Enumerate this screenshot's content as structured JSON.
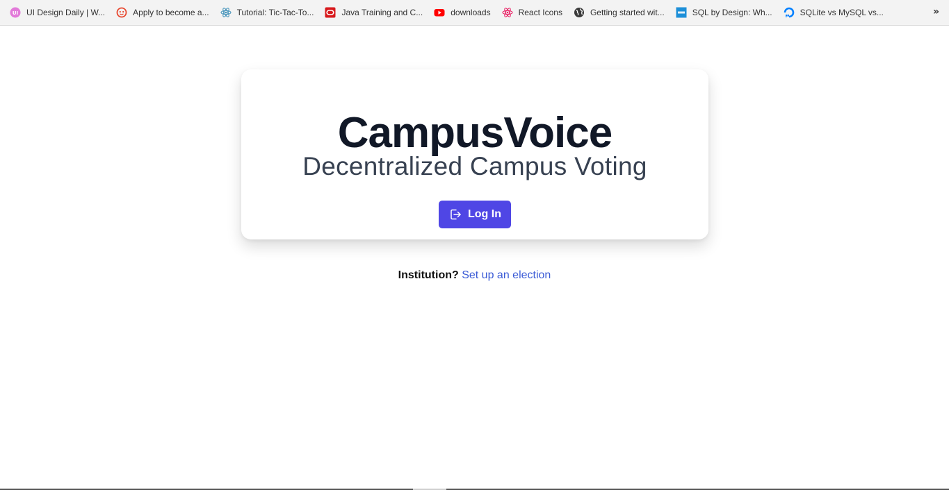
{
  "bookmarks": [
    {
      "label": "UI Design Daily | W...",
      "icon": "ui-design-daily-icon"
    },
    {
      "label": "Apply to become a...",
      "icon": "smiley-face-icon"
    },
    {
      "label": "Tutorial: Tic-Tac-To...",
      "icon": "react-atom-icon"
    },
    {
      "label": "Java Training and C...",
      "icon": "oracle-icon"
    },
    {
      "label": "downloads",
      "icon": "youtube-icon"
    },
    {
      "label": "React Icons",
      "icon": "react-icons-icon"
    },
    {
      "label": "Getting started wit...",
      "icon": "globe-icon"
    },
    {
      "label": "SQL by Design: Wh...",
      "icon": "itpro-icon"
    },
    {
      "label": "SQLite vs MySQL vs...",
      "icon": "digitalocean-icon"
    }
  ],
  "overflow_icon": "chevron-double-right-icon",
  "overflow_glyph": "»",
  "card": {
    "title": "CampusVoice",
    "subtitle": "Decentralized Campus Voting",
    "login_label": "Log In",
    "login_icon": "sign-in-icon"
  },
  "footer": {
    "institution_label": "Institution?",
    "setup_link": "Set up an election"
  },
  "colors": {
    "accent": "#4f46e5",
    "link": "#3b5bd6",
    "title": "#111827",
    "subtitle": "#374151"
  }
}
